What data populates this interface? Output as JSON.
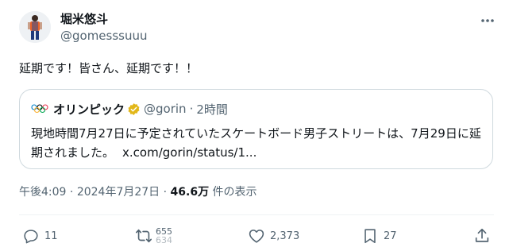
{
  "author": {
    "display_name": "堀米悠斗",
    "handle": "@gomesssuuu"
  },
  "tweet": {
    "text": "延期です！皆さん、延期です！！"
  },
  "quoted": {
    "display_name": "オリンピック",
    "handle": "@gorin",
    "separator": "·",
    "time_ago": "2時間",
    "body": "現地時間7月27日に予定されていたスケートボード男子ストリートは、7月29日に延期されました。",
    "link": "x.com/gorin/status/1..."
  },
  "meta": {
    "time": "午後4:09",
    "sep1": "·",
    "date": "2024年7月27日",
    "sep2": "·",
    "views_count": "46.6万",
    "views_label": "件の表示"
  },
  "actions": {
    "replies": "11",
    "retweets_top": "655",
    "retweets_bottom": "634",
    "likes": "2,373",
    "bookmarks": "27"
  },
  "colors": {
    "text_primary": "#0f1419",
    "text_secondary": "#536471",
    "border": "#cfd9de",
    "verified_gold": "#e2b719"
  },
  "icons": {
    "more": "more-horizontal-icon",
    "reply": "reply-icon",
    "retweet": "retweet-icon",
    "like": "heart-icon",
    "bookmark": "bookmark-icon",
    "share": "share-icon",
    "verified": "verified-badge-icon",
    "olympic_logo": "olympic-rings-icon"
  }
}
